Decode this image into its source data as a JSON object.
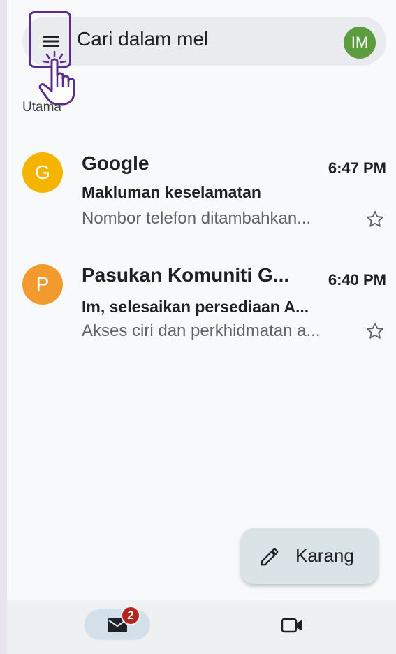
{
  "search": {
    "placeholder": "Cari dalam mel",
    "avatar_initials": "IM"
  },
  "section_label": "Utama",
  "emails": [
    {
      "avatar_letter": "G",
      "avatar_color": "#f4b400",
      "sender": "Google",
      "time": "6:47 PM",
      "subject": "Makluman keselamatan",
      "snippet": "Nombor telefon ditambahkan..."
    },
    {
      "avatar_letter": "P",
      "avatar_color": "#f29a2e",
      "sender": "Pasukan Komuniti G...",
      "time": "6:40 PM",
      "subject": "Im, selesaikan persediaan A...",
      "snippet": "Akses ciri dan perkhidmatan a..."
    }
  ],
  "fab": {
    "label": "Karang"
  },
  "bottom_nav": {
    "mail_badge": "2"
  },
  "icons": [
    "menu-icon",
    "star-icon",
    "pencil-icon",
    "mail-icon",
    "video-icon",
    "pointer-hand-icon"
  ],
  "colors": {
    "accent_highlight": "#5a2d8c",
    "badge": "#b3261e",
    "avatar_im": "#5c9c3f"
  }
}
